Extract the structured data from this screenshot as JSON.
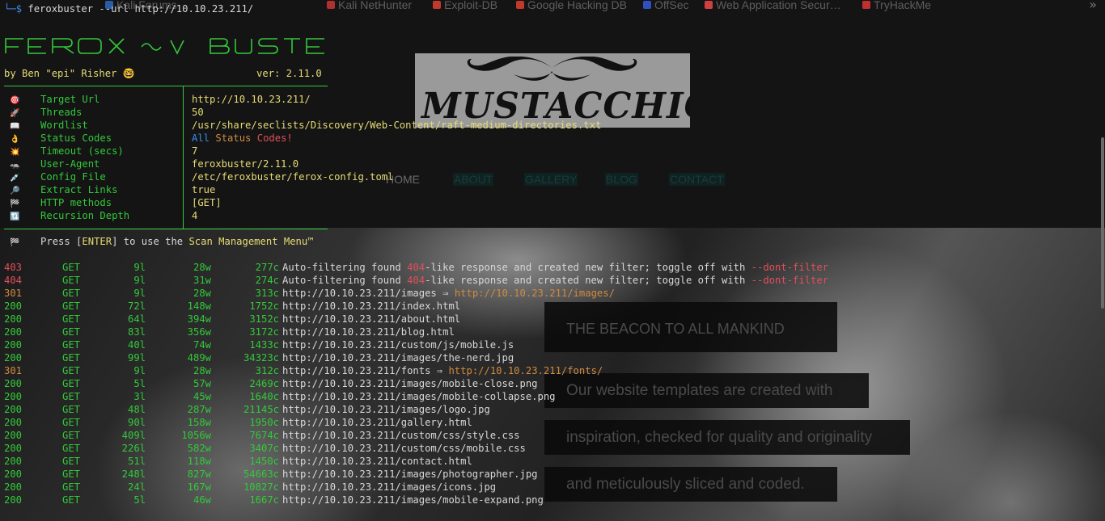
{
  "browser_bookmarks": [
    {
      "label": "Kali Forums",
      "icon": "kali-icon",
      "color": "#2a5ca8"
    },
    {
      "label": "Kali NetHunter",
      "icon": "kali-icon",
      "color": "#b03030"
    },
    {
      "label": "Exploit-DB",
      "icon": "exploitdb-icon",
      "color": "#c0392b"
    },
    {
      "label": "Google Hacking DB",
      "icon": "ghdb-icon",
      "color": "#c0392b"
    },
    {
      "label": "OffSec",
      "icon": "offsec-icon",
      "color": "#3050c0"
    },
    {
      "label": "Web Application Secur…",
      "icon": "bolt-icon",
      "color": "#d04040"
    },
    {
      "label": "TryHackMe",
      "icon": "thm-icon",
      "color": "#c03030"
    }
  ],
  "website": {
    "logo_text": "MUSTACCHIO",
    "nav": [
      "HOME",
      "ABOUT",
      "GALLERY",
      "BLOG",
      "CONTACT"
    ],
    "headline": "THE BEACON TO ALL MANKIND",
    "tagline_lines": [
      "Our website templates are created with",
      "inspiration, checked for quality and originality",
      "and meticulously sliced and coded."
    ]
  },
  "terminal": {
    "prompt_prefix": "└─",
    "prompt_symbol": "$",
    "command": "feroxbuster --url http://10.10.23.211/",
    "byline": "by Ben \"epi\" Risher 🤓",
    "version": "ver: 2.11.0",
    "config": [
      {
        "icon": "target-icon",
        "glyph": "🎯",
        "label": "Target Url",
        "value": "http://10.10.23.211/"
      },
      {
        "icon": "rocket-icon",
        "glyph": "🚀",
        "label": "Threads",
        "value": "50"
      },
      {
        "icon": "book-icon",
        "glyph": "📖",
        "label": "Wordlist",
        "value": "/usr/share/seclists/Discovery/Web-Content/raft-medium-directories.txt"
      },
      {
        "icon": "ok-hand-icon",
        "glyph": "👌",
        "label": "Status Codes",
        "value_parts": [
          "All",
          "Status",
          "Codes!"
        ]
      },
      {
        "icon": "timer-icon",
        "glyph": "💥",
        "label": "Timeout (secs)",
        "value": "7"
      },
      {
        "icon": "badger-icon",
        "glyph": "🦡",
        "label": "User-Agent",
        "value": "feroxbuster/2.11.0"
      },
      {
        "icon": "syringe-icon",
        "glyph": "💉",
        "label": "Config File",
        "value": "/etc/feroxbuster/ferox-config.toml"
      },
      {
        "icon": "magnifier-icon",
        "glyph": "🔎",
        "label": "Extract Links",
        "value": "true"
      },
      {
        "icon": "flag-icon",
        "glyph": "🏁",
        "label": "HTTP methods",
        "value": "[GET]"
      },
      {
        "icon": "recursion-icon",
        "glyph": "🔃",
        "label": "Recursion Depth",
        "value": "4"
      }
    ],
    "press_hint": {
      "glyph": "🏁",
      "pre": "Press [",
      "key": "ENTER",
      "mid": "] to use the ",
      "menu": "Scan Management Menu™"
    },
    "results": [
      {
        "status": "403",
        "method": "GET",
        "lines": "9l",
        "words": "28w",
        "chars": "277c",
        "msg": "Auto-filtering found ",
        "code": "404",
        "msg2": "-like response and created new filter; toggle off with ",
        "flag": "--dont-filter"
      },
      {
        "status": "404",
        "method": "GET",
        "lines": "9l",
        "words": "31w",
        "chars": "274c",
        "msg": "Auto-filtering found ",
        "code": "404",
        "msg2": "-like response and created new filter; toggle off with ",
        "flag": "--dont-filter"
      },
      {
        "status": "301",
        "method": "GET",
        "lines": "9l",
        "words": "28w",
        "chars": "313c",
        "url": "http://10.10.23.211/images",
        "redirect": "http://10.10.23.211/images/"
      },
      {
        "status": "200",
        "method": "GET",
        "lines": "72l",
        "words": "148w",
        "chars": "1752c",
        "url": "http://10.10.23.211/index.html"
      },
      {
        "status": "200",
        "method": "GET",
        "lines": "64l",
        "words": "394w",
        "chars": "3152c",
        "url": "http://10.10.23.211/about.html"
      },
      {
        "status": "200",
        "method": "GET",
        "lines": "83l",
        "words": "356w",
        "chars": "3172c",
        "url": "http://10.10.23.211/blog.html"
      },
      {
        "status": "200",
        "method": "GET",
        "lines": "40l",
        "words": "74w",
        "chars": "1433c",
        "url": "http://10.10.23.211/custom/js/mobile.js"
      },
      {
        "status": "200",
        "method": "GET",
        "lines": "99l",
        "words": "489w",
        "chars": "34323c",
        "url": "http://10.10.23.211/images/the-nerd.jpg"
      },
      {
        "status": "301",
        "method": "GET",
        "lines": "9l",
        "words": "28w",
        "chars": "312c",
        "url": "http://10.10.23.211/fonts",
        "redirect": "http://10.10.23.211/fonts/"
      },
      {
        "status": "200",
        "method": "GET",
        "lines": "5l",
        "words": "57w",
        "chars": "2469c",
        "url": "http://10.10.23.211/images/mobile-close.png"
      },
      {
        "status": "200",
        "method": "GET",
        "lines": "3l",
        "words": "45w",
        "chars": "1640c",
        "url": "http://10.10.23.211/images/mobile-collapse.png"
      },
      {
        "status": "200",
        "method": "GET",
        "lines": "48l",
        "words": "287w",
        "chars": "21145c",
        "url": "http://10.10.23.211/images/logo.jpg"
      },
      {
        "status": "200",
        "method": "GET",
        "lines": "90l",
        "words": "158w",
        "chars": "1950c",
        "url": "http://10.10.23.211/gallery.html"
      },
      {
        "status": "200",
        "method": "GET",
        "lines": "409l",
        "words": "1056w",
        "chars": "7674c",
        "url": "http://10.10.23.211/custom/css/style.css"
      },
      {
        "status": "200",
        "method": "GET",
        "lines": "226l",
        "words": "582w",
        "chars": "3407c",
        "url": "http://10.10.23.211/custom/css/mobile.css"
      },
      {
        "status": "200",
        "method": "GET",
        "lines": "51l",
        "words": "118w",
        "chars": "1450c",
        "url": "http://10.10.23.211/contact.html"
      },
      {
        "status": "200",
        "method": "GET",
        "lines": "248l",
        "words": "827w",
        "chars": "54663c",
        "url": "http://10.10.23.211/images/photographer.jpg"
      },
      {
        "status": "200",
        "method": "GET",
        "lines": "24l",
        "words": "167w",
        "chars": "10827c",
        "url": "http://10.10.23.211/images/icons.jpg"
      },
      {
        "status": "200",
        "method": "GET",
        "lines": "5l",
        "words": "46w",
        "chars": "1667c",
        "url": "http://10.10.23.211/images/mobile-expand.png"
      }
    ],
    "status_colors": {
      "200": "#33c93a",
      "301": "#d08a40",
      "403": "#e0505a",
      "404": "#e0505a"
    },
    "redirect_arrow": "⇒"
  }
}
